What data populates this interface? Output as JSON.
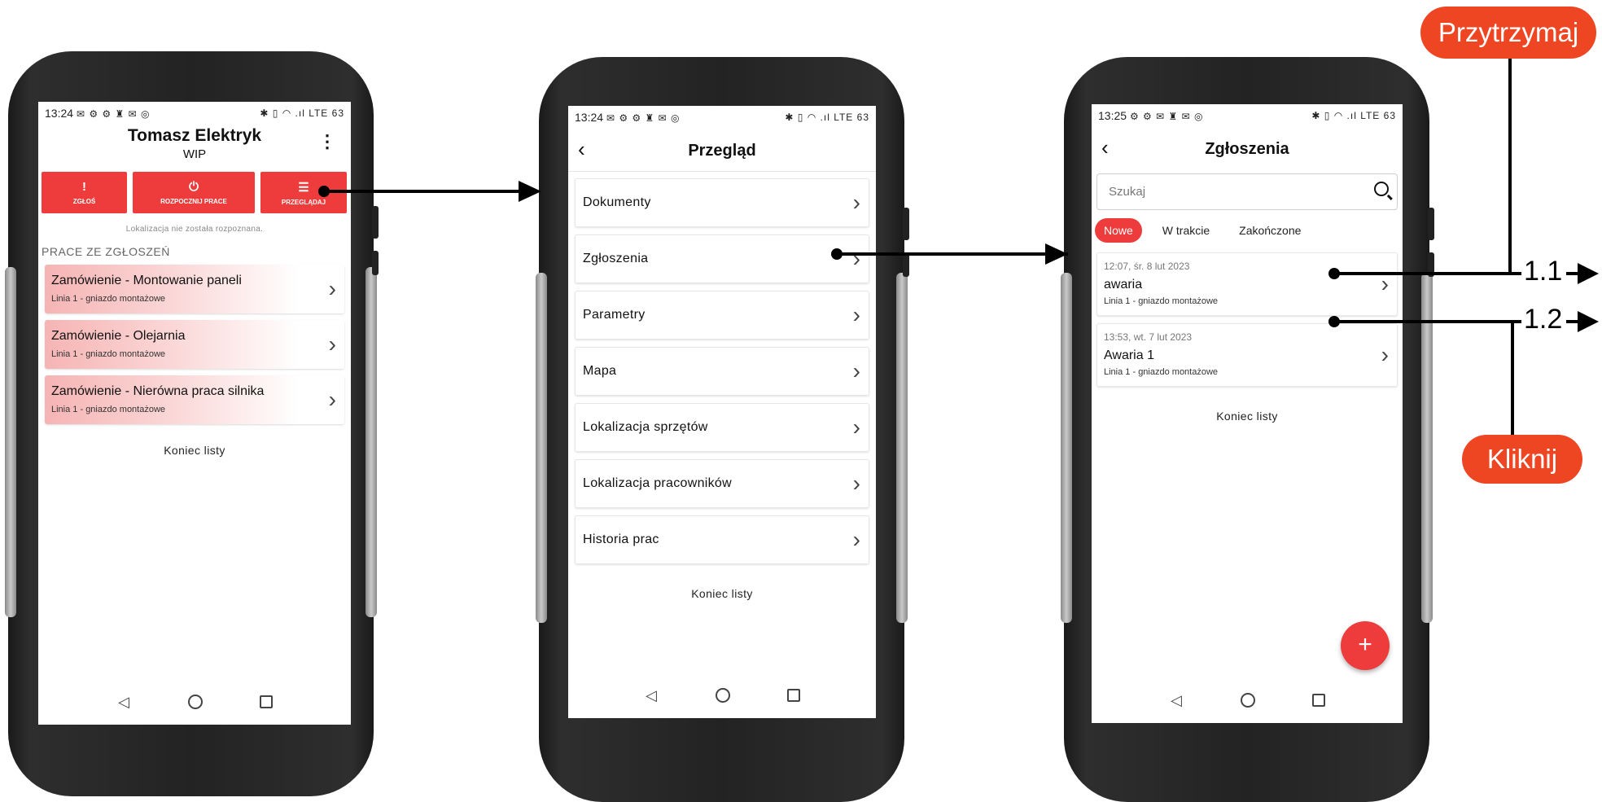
{
  "phone1": {
    "status_time": "13:24",
    "status_icons": "✉ ⚙ ⚙ ♜ ✉ ◎",
    "status_right": "✱ ▯ ◠ .ıl LTE 63",
    "name": "Tomasz Elektryk",
    "subtitle": "WIP",
    "actions": [
      {
        "label": "ZGŁOŚ",
        "icon": "!"
      },
      {
        "label": "ROZPOCZNIJ PRACE",
        "icon": "⏻"
      },
      {
        "label": "PRZEGLĄDAJ",
        "icon": "☰"
      }
    ],
    "location_msg": "Lokalizacja nie została rozpoznana.",
    "section_title": "PRACE ZE ZGŁOSZEŃ",
    "jobs": [
      {
        "title": "Zamówienie - Montowanie paneli",
        "sub": "Linia 1 - gniazdo montażowe"
      },
      {
        "title": "Zamówienie - Olejarnia",
        "sub": "Linia 1 - gniazdo montażowe"
      },
      {
        "title": "Zamówienie - Nierówna praca silnika",
        "sub": "Linia 1 - gniazdo montażowe"
      }
    ],
    "end": "Koniec listy"
  },
  "phone2": {
    "status_time": "13:24",
    "status_icons": "✉ ⚙ ⚙ ♜ ✉ ◎",
    "status_right": "✱ ▯ ◠ .ıl LTE 63",
    "title": "Przegląd",
    "items": [
      "Dokumenty",
      "Zgłoszenia",
      "Parametry",
      "Mapa",
      "Lokalizacja sprzętów",
      "Lokalizacja pracowników",
      "Historia prac"
    ],
    "end": "Koniec listy"
  },
  "phone3": {
    "status_time": "13:25",
    "status_icons": "⚙ ⚙ ✉ ♜ ✉ ◎",
    "status_right": "✱ ▯ ◠ .ıl LTE 63",
    "title": "Zgłoszenia",
    "search_placeholder": "Szukaj",
    "tabs": [
      "Nowe",
      "W trakcie",
      "Zakończone"
    ],
    "tickets": [
      {
        "date": "12:07, śr. 8 lut 2023",
        "name": "awaria",
        "sub": "Linia 1 - gniazdo montażowe"
      },
      {
        "date": "13:53, wt. 7 lut 2023",
        "name": "Awaria 1",
        "sub": "Linia 1 - gniazdo montażowe"
      }
    ],
    "end": "Koniec listy",
    "fab": "+"
  },
  "annotations": {
    "hold": "Przytrzymaj",
    "click": "Kliknij",
    "step1": "1.1",
    "step2": "1.2"
  },
  "colors": {
    "accent": "#ee3b3b",
    "annotation": "#ee4523"
  }
}
